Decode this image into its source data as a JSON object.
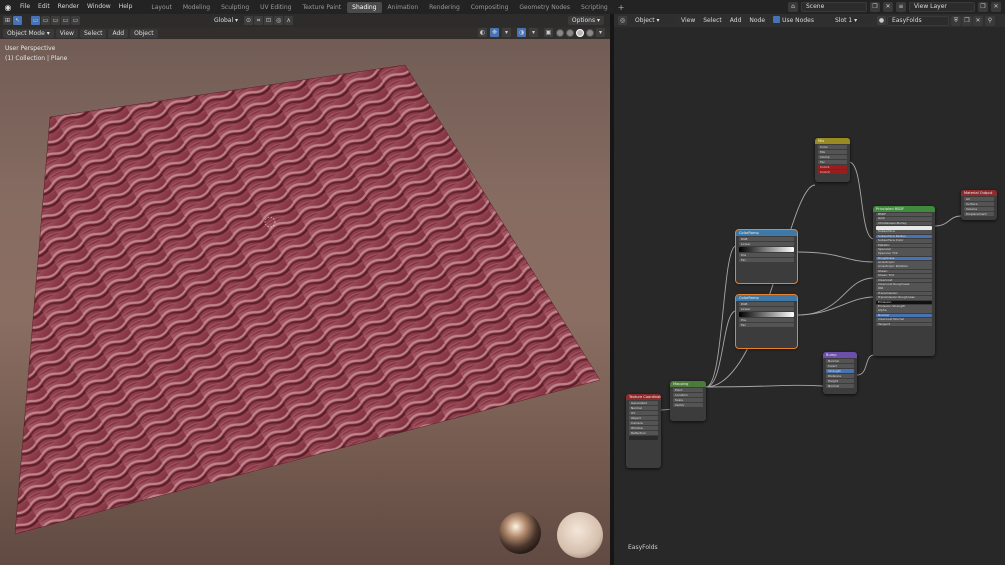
{
  "menubar": {
    "items": [
      "File",
      "Edit",
      "Render",
      "Window",
      "Help"
    ],
    "workspaces": [
      "Layout",
      "Modeling",
      "Sculpting",
      "UV Editing",
      "Texture Paint",
      "Shading",
      "Animation",
      "Rendering",
      "Compositing",
      "Geometry Nodes",
      "Scripting"
    ],
    "active_workspace": "Shading",
    "scene": "Scene",
    "view_layer": "View Layer"
  },
  "viewport": {
    "mode": "Object Mode",
    "menus": [
      "View",
      "Select",
      "Add",
      "Object"
    ],
    "transform_orientation": "Global",
    "options_label": "Options",
    "perspective_label": "User Perspective",
    "collection_label": "(1) Collection | Plane"
  },
  "node_editor": {
    "object_type": "Object",
    "menus": [
      "View",
      "Select",
      "Add",
      "Node"
    ],
    "use_nodes_label": "Use Nodes",
    "slot": "Slot 1",
    "material": "EasyFolds",
    "footer_label": "EasyFolds"
  },
  "nodes": {
    "texcoord": {
      "title": "Texture Coordinate",
      "rows": [
        "Generated",
        "Normal",
        "UV",
        "Object",
        "Camera",
        "Window",
        "Reflection"
      ]
    },
    "mapping": {
      "title": "Mapping",
      "rows": [
        "Point",
        "Location",
        "Scale",
        "Vector"
      ]
    },
    "colorramp1": {
      "title": "ColorRamp",
      "rows": [
        "RGB",
        "Linear",
        "Pos",
        "Fac"
      ]
    },
    "colorramp2": {
      "title": "ColorRamp",
      "rows": [
        "RGB",
        "Linear",
        "Pos",
        "Fac"
      ]
    },
    "mix": {
      "title": "Mix",
      "rows": [
        "Color",
        "Mix",
        "Clamp",
        "Fac",
        "Color1",
        "Color2"
      ]
    },
    "bump": {
      "title": "Bump",
      "rows": [
        "Normal",
        "Invert",
        "Strength",
        "Distance",
        "Height",
        "Normal"
      ]
    },
    "principled": {
      "title": "Principled BSDF",
      "rows": [
        "BSDF",
        "GGX",
        "Christensen-Burley",
        "Base Color",
        "Subsurface",
        "Subsurface Radius",
        "Subsurface Color",
        "Metallic",
        "Specular",
        "Specular Tint",
        "Roughness",
        "Anisotropic",
        "Anisotropic Rotation",
        "Sheen",
        "Sheen Tint",
        "Clearcoat",
        "Clearcoat Roughness",
        "IOR",
        "Transmission",
        "Transmission Roughness",
        "Emission",
        "Emission Strength",
        "Alpha",
        "Normal",
        "Clearcoat Normal",
        "Tangent"
      ]
    },
    "output": {
      "title": "Material Output",
      "rows": [
        "All",
        "Surface",
        "Volume",
        "Displacement"
      ]
    }
  },
  "colors": {
    "accent": "#4772b3",
    "header_dark": "#232323",
    "node_bg": "#3c3c3c",
    "material": "#8c2a34"
  }
}
